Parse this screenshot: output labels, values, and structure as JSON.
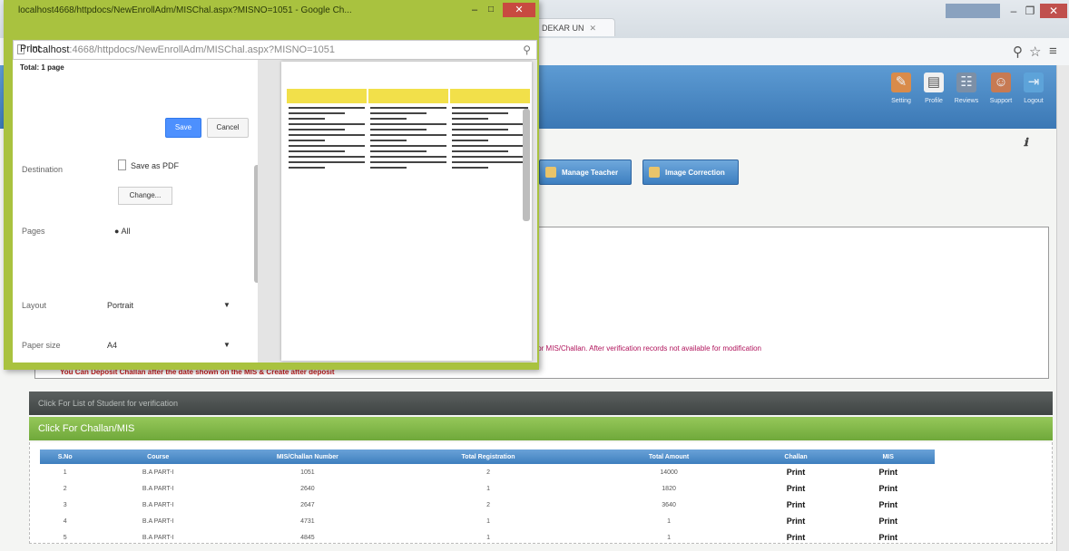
{
  "print_window": {
    "title": "localhost4668/httpdocs/NewEnrollAdm/MISChal.aspx?MISNO=1051 - Google Ch...",
    "url_host": "localhost",
    "url_rest": ":4668/httpdocs/NewEnrollAdm/MISChal.aspx?MISNO=1051",
    "minimize": "–",
    "maximize": "□",
    "close": "✕"
  },
  "print_panel": {
    "title": "Print",
    "total": "Total: 1 page",
    "save_label": "Save",
    "cancel_label": "Cancel",
    "destination_label": "Destination",
    "destination_value": "Save as PDF",
    "change_label": "Change...",
    "pages_label": "Pages",
    "pages_value": "All",
    "layout_label": "Layout",
    "layout_value": "Portrait",
    "paper_label": "Paper size",
    "paper_value": "A4"
  },
  "browser": {
    "tab_label": "DEKAR UN",
    "tab_close": "✕",
    "menu_icon": "≡",
    "star_icon": "☆",
    "zoom_icon": "⚲"
  },
  "nav": [
    {
      "label": "Setting",
      "icon": "key-icon",
      "glyph": "✎"
    },
    {
      "label": "Profile",
      "icon": "profile-icon",
      "glyph": "▤"
    },
    {
      "label": "Reviews",
      "icon": "users-icon",
      "glyph": "☷"
    },
    {
      "label": "Support",
      "icon": "support-icon",
      "glyph": "☺"
    },
    {
      "label": "Logout",
      "icon": "logout-icon",
      "glyph": "⇥"
    }
  ],
  "buttons": {
    "manage_teacher": "Manage Teacher",
    "image_correction": "Image Correction"
  },
  "info": {
    "red_text": "for MIS/Challan. After verification records not available for modification",
    "red_text2": "You Can Deposit Challan after the date shown on the MIS & Create after deposit"
  },
  "sections": {
    "verification_bar": "Click For List of Student for verification",
    "challan_bar": "Click For Challan/MIS"
  },
  "table": {
    "columns": [
      "S.No",
      "Course",
      "MIS/Challan Number",
      "Total Registration",
      "Total Amount",
      "Challan",
      "MIS"
    ],
    "rows": [
      [
        "1",
        "B.A PART-I",
        "1051",
        "2",
        "14000",
        "Print",
        "Print"
      ],
      [
        "2",
        "B.A PART-I",
        "2640",
        "1",
        "1820",
        "Print",
        "Print"
      ],
      [
        "3",
        "B.A PART-I",
        "2647",
        "2",
        "3640",
        "Print",
        "Print"
      ],
      [
        "4",
        "B.A PART-I",
        "4731",
        "1",
        "1",
        "Print",
        "Print"
      ],
      [
        "5",
        "B.A PART-I",
        "4845",
        "1",
        "1",
        "Print",
        "Print"
      ]
    ]
  }
}
